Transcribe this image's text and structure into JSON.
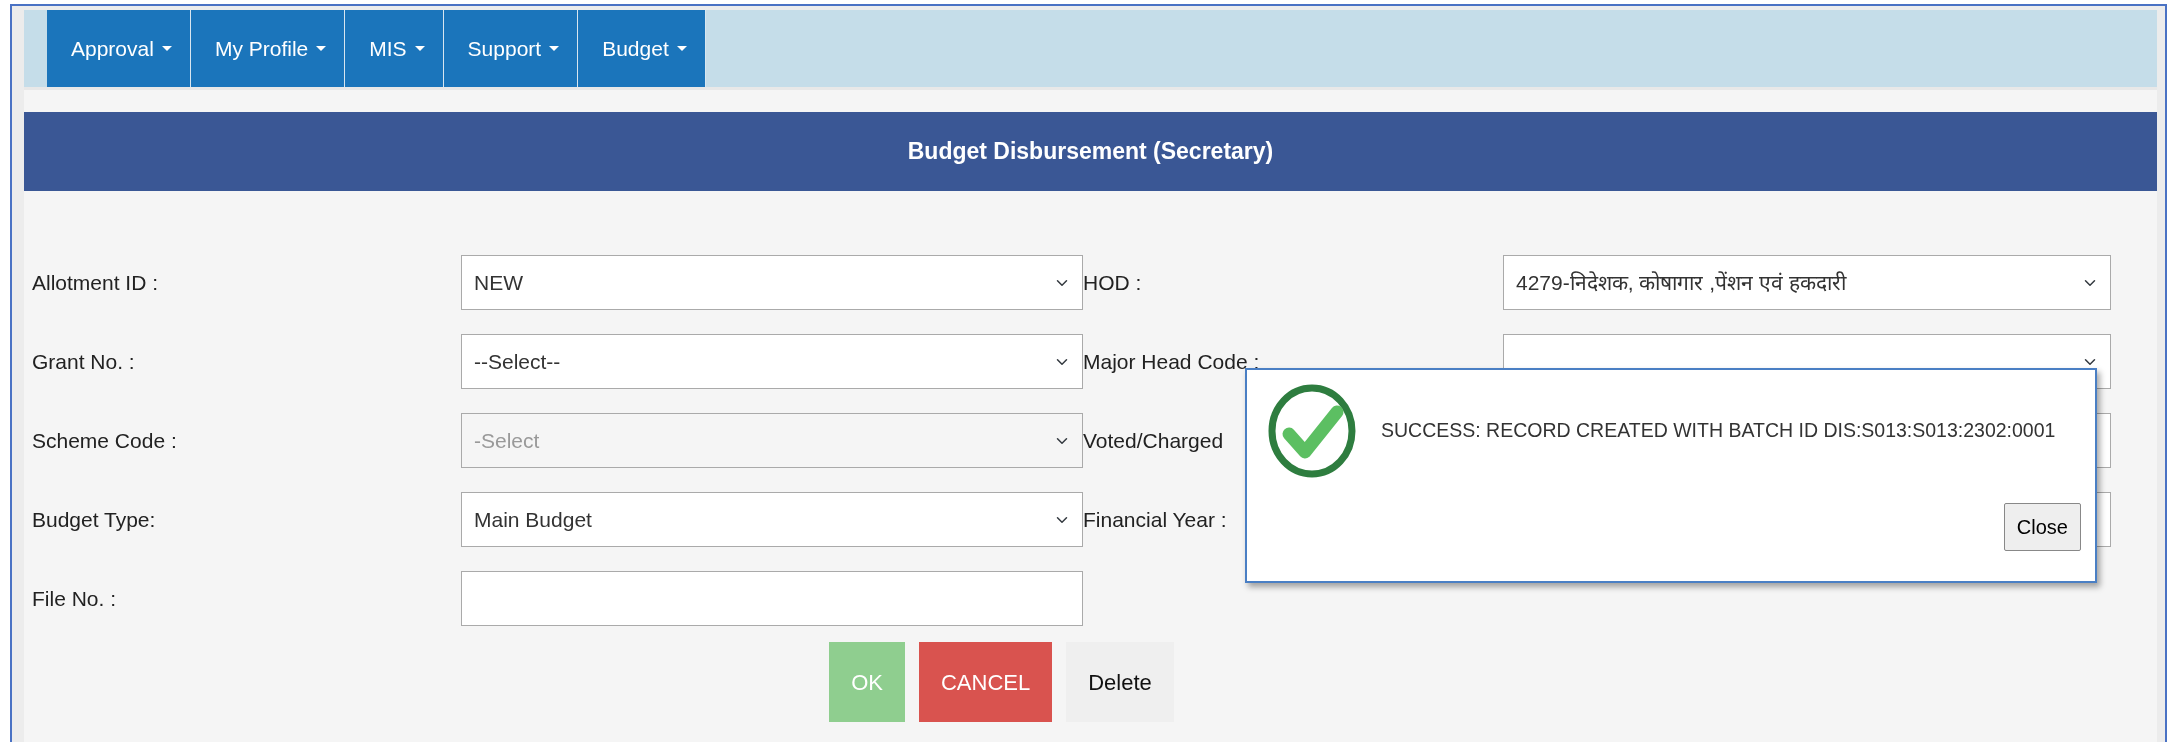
{
  "nav": {
    "items": [
      {
        "label": "Approval"
      },
      {
        "label": "My Profile"
      },
      {
        "label": "MIS"
      },
      {
        "label": "Support"
      },
      {
        "label": "Budget"
      }
    ]
  },
  "page_title": "Budget Disbursement (Secretary)",
  "form": {
    "rows": [
      {
        "left": {
          "label": "Allotment ID :",
          "kind": "select",
          "value": "NEW",
          "disabled": false
        },
        "right": {
          "label": "HOD :",
          "kind": "select",
          "value": "4279-निदेशक, कोषागार ,पेंशन एवं हकदारी",
          "disabled": false
        }
      },
      {
        "left": {
          "label": "Grant No. :",
          "kind": "select",
          "value": "--Select--",
          "disabled": false
        },
        "right": {
          "label": "Major Head Code :",
          "kind": "select"
        }
      },
      {
        "left": {
          "label": "Scheme Code :",
          "kind": "select",
          "value": "-Select",
          "disabled": true
        },
        "right": {
          "label": "Voted/Charged",
          "kind": "select"
        }
      },
      {
        "left": {
          "label": "Budget Type:",
          "kind": "select",
          "value": "Main Budget",
          "disabled": false
        },
        "right": {
          "label": "Financial Year :",
          "kind": "select"
        }
      },
      {
        "left": {
          "label": "File No. :",
          "kind": "text"
        }
      }
    ]
  },
  "buttons": [
    {
      "label": "OK",
      "kind": "success",
      "disabled": true
    },
    {
      "label": "CANCEL",
      "kind": "danger"
    },
    {
      "label": "Delete",
      "kind": "light"
    }
  ],
  "dialog": {
    "message": "SUCCESS: RECORD CREATED WITH BATCH ID DIS:S013:S013:2302:0001",
    "close": "Close"
  }
}
